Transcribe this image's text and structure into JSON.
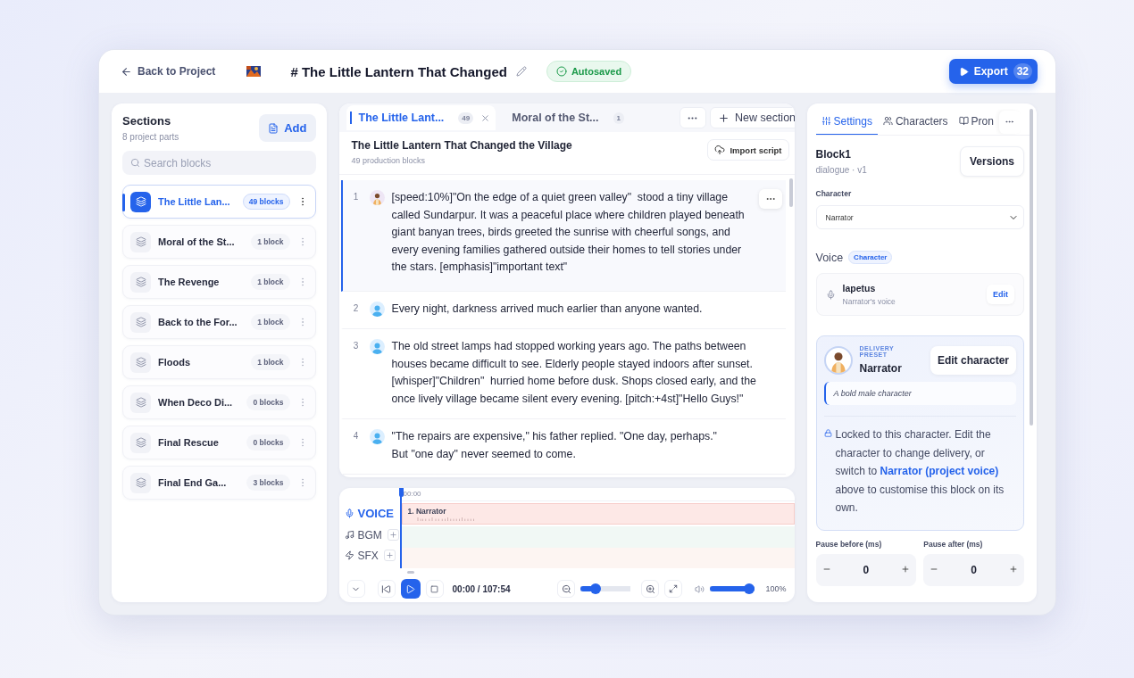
{
  "header": {
    "back_link": "Back to Project",
    "title": "# The Little Lantern That Changed",
    "status": "Autosaved",
    "export": {
      "label": "Export",
      "count": "32"
    }
  },
  "sections": {
    "title": "Sections",
    "subtitle": "8 project parts",
    "add_label": "Add",
    "search_placeholder": "Search blocks",
    "items": [
      {
        "name": "The Little Lan...",
        "count": "49 blocks",
        "selected": true
      },
      {
        "name": "Moral of the St...",
        "count": "1 block",
        "selected": false
      },
      {
        "name": "The Revenge",
        "count": "1 block",
        "selected": false
      },
      {
        "name": "Back to the For...",
        "count": "1 block",
        "selected": false
      },
      {
        "name": "Floods",
        "count": "1 block",
        "selected": false
      },
      {
        "name": "When Deco Di...",
        "count": "0 blocks",
        "selected": false
      },
      {
        "name": "Final Rescue",
        "count": "0 blocks",
        "selected": false
      },
      {
        "name": "Final End Ga...",
        "count": "3 blocks",
        "selected": false
      }
    ]
  },
  "editor": {
    "tabs": [
      {
        "label": "The Little Lant...",
        "count": "49",
        "selected": true,
        "closable": true
      },
      {
        "label": "Moral of the St...",
        "count": "1",
        "selected": false,
        "closable": false
      }
    ],
    "new_section": "New section",
    "title": "The Little Lantern That Changed the Village",
    "subtitle": "49 production blocks",
    "import_label": "Import script",
    "blocks": [
      {
        "number": "1",
        "kind": "character",
        "selected": true,
        "text": "[speed:10%]\"On the edge of a quiet green valley\"  stood a tiny village called Sundarpur. It was a peaceful place where children played beneath giant banyan trees, birds greeted the sunrise with cheerful songs, and every evening families gathered outside their homes to tell stories under the stars. [emphasis]\"important text\""
      },
      {
        "number": "2",
        "kind": "person",
        "selected": false,
        "text": "Every night, darkness arrived much earlier than anyone wanted."
      },
      {
        "number": "3",
        "kind": "person",
        "selected": false,
        "text": "The old street lamps had stopped working years ago. The paths between houses became difficult to see. Elderly people stayed indoors after sunset. [whisper]\"Children\"  hurried home before dusk. Shops closed early, and the once lively village became silent every evening. [pitch:+4st]\"Hello Guys!\""
      },
      {
        "number": "4",
        "kind": "person",
        "selected": false,
        "text": "\"The repairs are expensive,\" his father replied. \"One day, perhaps.\"\nBut \"one day\" never seemed to come."
      }
    ]
  },
  "timeline": {
    "ruler_start": "00:00",
    "tracks": [
      {
        "kind": "voice",
        "label": "VOICE",
        "selected": true,
        "clip": "1. Narrator"
      },
      {
        "kind": "bgm",
        "label": "BGM",
        "selected": false
      },
      {
        "kind": "sfx",
        "label": "SFX",
        "selected": false
      }
    ],
    "time": "00:00 / 107:54",
    "zoom": {
      "level": 0.25
    },
    "volume": {
      "level": 1.0
    },
    "volume_reading": "100%"
  },
  "inspector": {
    "tabs": [
      {
        "label": "Settings",
        "kind": "settings",
        "selected": true
      },
      {
        "label": "Characters",
        "kind": "characters",
        "selected": false
      },
      {
        "label": "Pron",
        "kind": "book",
        "selected": false
      }
    ],
    "block_title": "Block1",
    "block_meta": "dialogue · v1",
    "versions": "Versions",
    "character_label": "Character",
    "character_value": "Narrator",
    "voice_label": "Voice",
    "voice_badge": "Character",
    "voice_name": "Iapetus",
    "voice_sub": "Narrator's voice",
    "voice_edit": "Edit",
    "preset_label": "DELIVERY PRESET",
    "preset_name": "Narrator",
    "edit_character": "Edit character",
    "description": "A bold male character",
    "lock_text": "Locked to this character. Edit the character to change delivery, or switch to **Narrator (project voice)** above to customise this block on its own.",
    "pauses": [
      {
        "label": "Pause before (ms)",
        "value": "0"
      },
      {
        "label": "Pause after (ms)",
        "value": "0"
      }
    ]
  }
}
